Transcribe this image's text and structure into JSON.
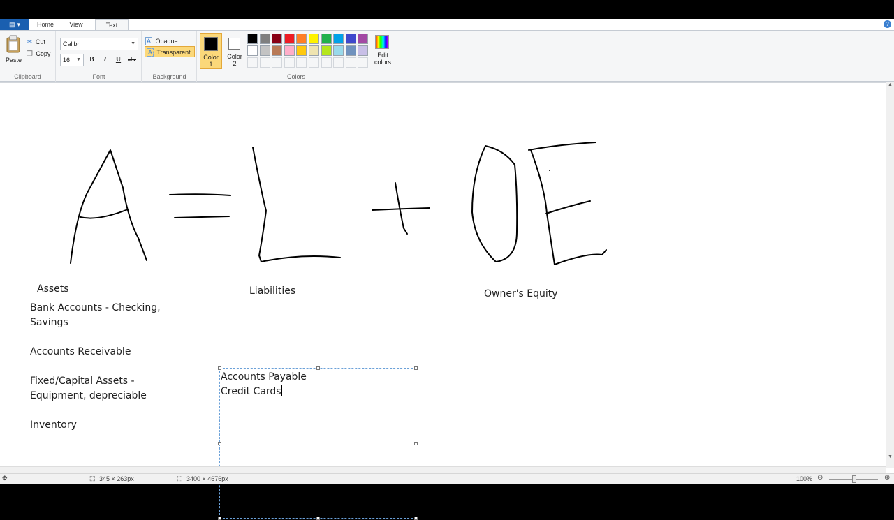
{
  "ribbon_tabs": {
    "home": "Home",
    "view": "View",
    "text": "Text"
  },
  "clipboard": {
    "paste": "Paste",
    "cut": "Cut",
    "copy": "Copy",
    "label": "Clipboard"
  },
  "font": {
    "family": "Calibri",
    "size": "16",
    "bold": "B",
    "italic": "I",
    "underline": "U",
    "strike": "abc",
    "label": "Font"
  },
  "background": {
    "opaque": "Opaque",
    "transparent": "Transparent",
    "label": "Background"
  },
  "colors": {
    "color1_label_1": "Color",
    "color1_label_2": "1",
    "color2_label_1": "Color",
    "color2_label_2": "2",
    "edit_label_1": "Edit",
    "edit_label_2": "colors",
    "label": "Colors",
    "color1": "#000000",
    "color2": "#ffffff",
    "row1": [
      "#000000",
      "#7f7f7f",
      "#880015",
      "#ed1c24",
      "#ff7f27",
      "#fff200",
      "#22b14c",
      "#00a2e8",
      "#3f48cc",
      "#a349a4"
    ],
    "row2": [
      "#ffffff",
      "#c3c3c3",
      "#b97a57",
      "#ffaec9",
      "#ffc90e",
      "#efe4b0",
      "#b5e61d",
      "#99d9ea",
      "#7092be",
      "#c8bfe7"
    ]
  },
  "canvas": {
    "assets_heading": "Assets",
    "assets_list": [
      "Bank Accounts - Checking,",
      "Savings",
      "",
      "Accounts Receivable",
      "",
      "Fixed/Capital Assets -",
      "Equipment, depreciable",
      "",
      "Inventory"
    ],
    "liabilities_heading": "Liabilities",
    "liabilities_list": [
      "Accounts Payable",
      "Credit Cards"
    ],
    "equity_heading": "Owner's Equity"
  },
  "status": {
    "selection_size": "345 × 263px",
    "image_size": "3400 × 4676px",
    "zoom": "100%"
  }
}
